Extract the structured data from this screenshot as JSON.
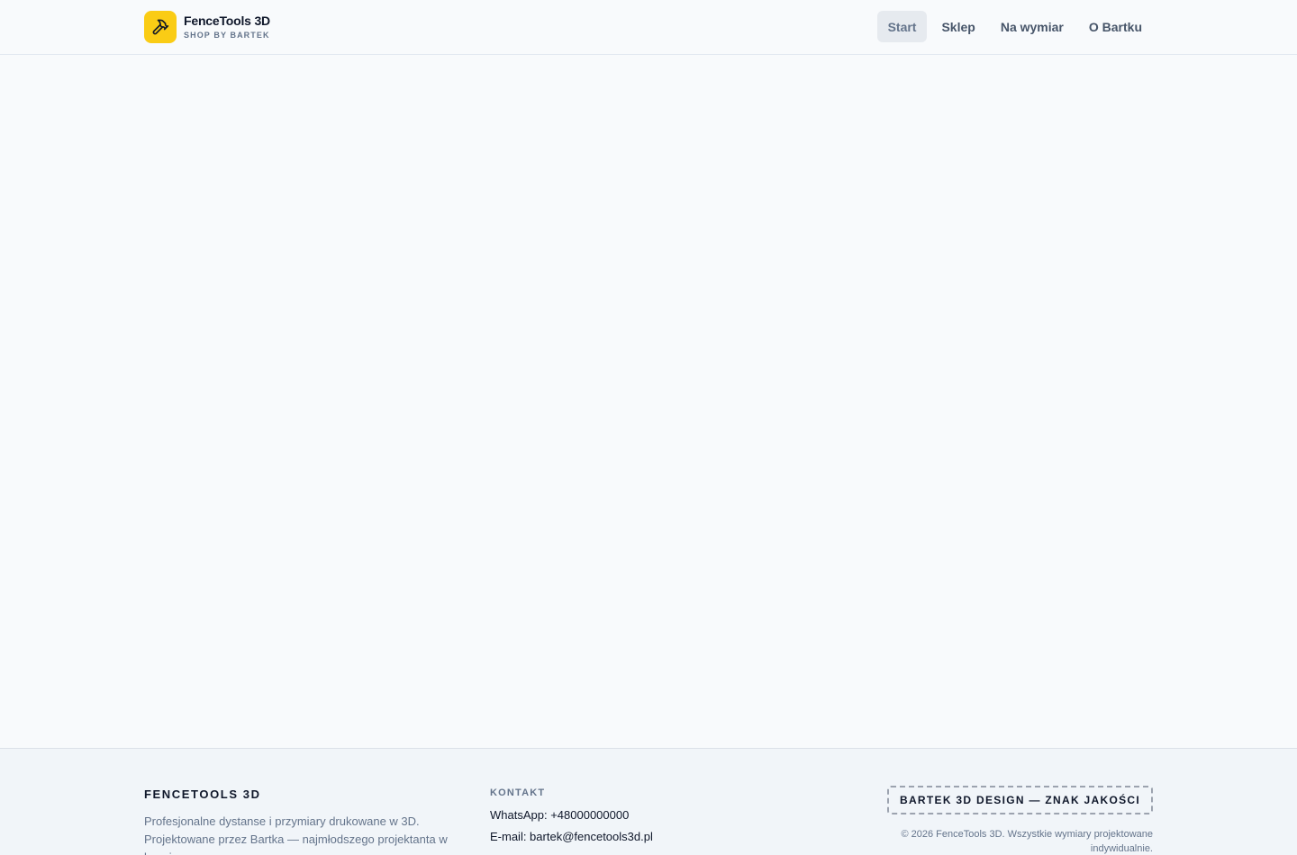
{
  "header": {
    "brand_name": "FenceTools 3D",
    "brand_tagline": "SHOP BY BARTEK",
    "logo_icon": "hammer-icon",
    "accent_color": "#facc15",
    "nav": [
      {
        "label": "Start",
        "active": true
      },
      {
        "label": "Sklep",
        "active": false
      },
      {
        "label": "Na wymiar",
        "active": false
      },
      {
        "label": "O Bartku",
        "active": false
      }
    ]
  },
  "footer": {
    "brand_title": "FENCETOOLS 3D",
    "description": "Profesjonalne dystanse i przymiary drukowane w 3D. Projektowane przez Bartka — najmłodszego projektanta w branży.",
    "contact": {
      "heading": "KONTAKT",
      "whatsapp": "WhatsApp: +48000000000",
      "email": "E-mail: bartek@fencetools3d.pl"
    },
    "quality_badge": "BARTEK 3D DESIGN — ZNAK JAKOŚCI",
    "copyright": "© 2026 FenceTools 3D. Wszystkie wymiary projektowane indywidualnie."
  }
}
